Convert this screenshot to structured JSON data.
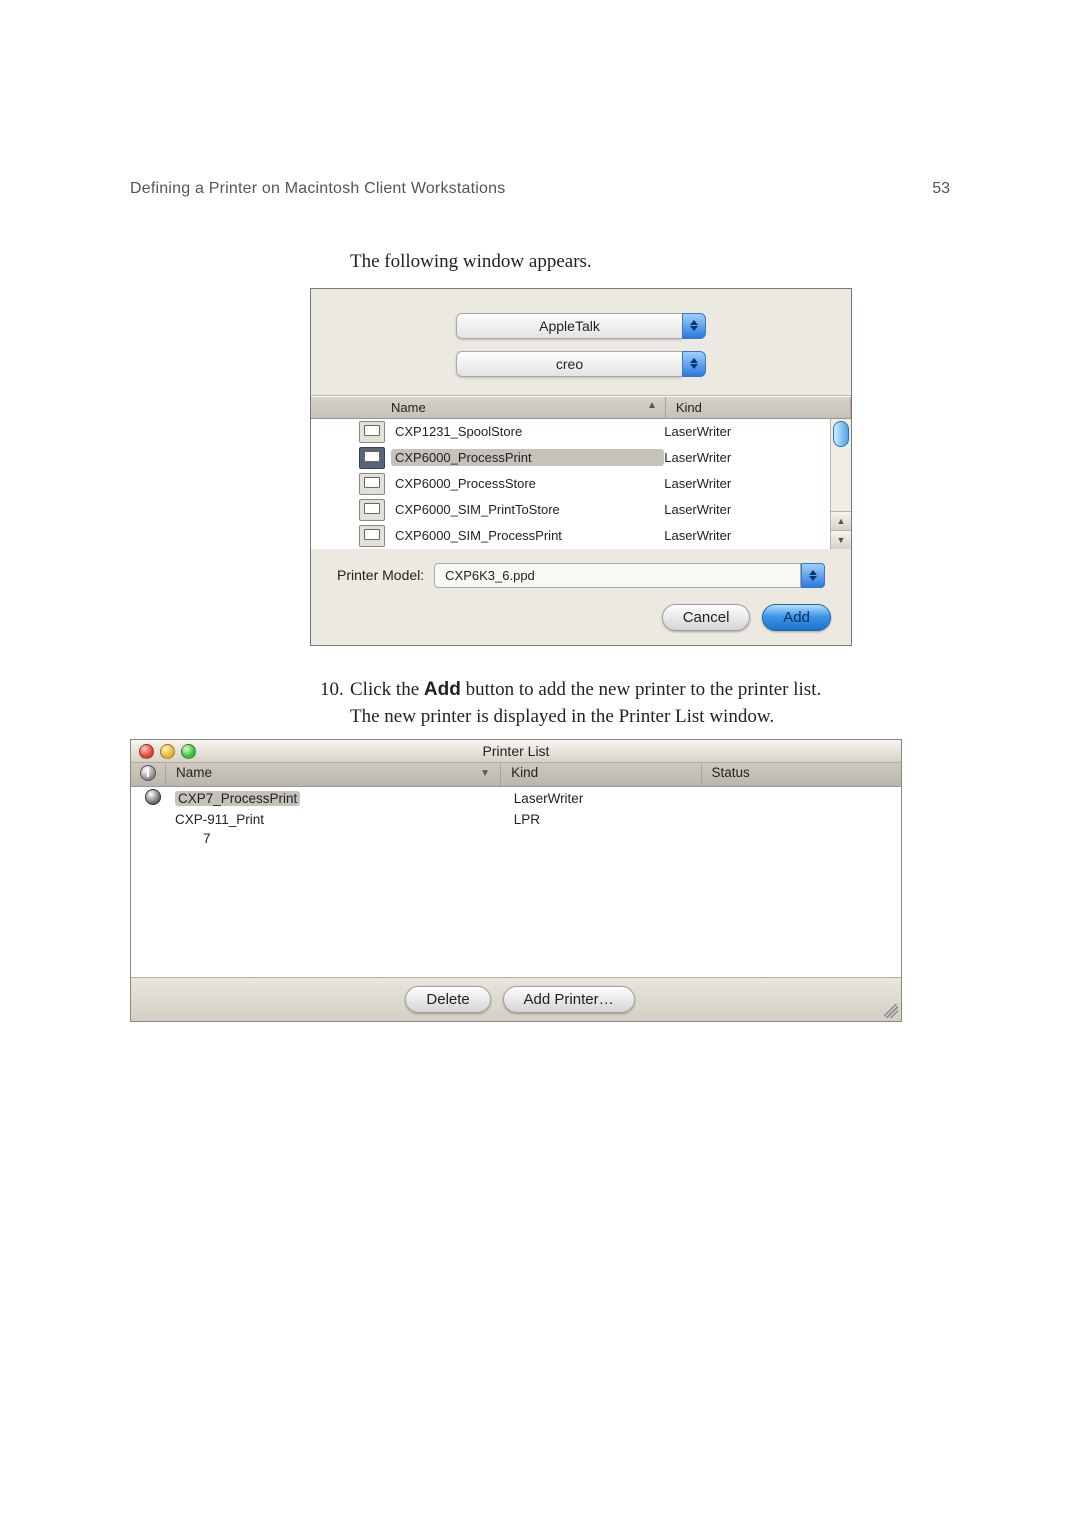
{
  "header": {
    "title": "Defining a Printer on Macintosh Client Workstations",
    "page_number": "53"
  },
  "intro_text": "The following window appears.",
  "dialog1": {
    "connection_select": "AppleTalk",
    "zone_select": "creo",
    "columns": {
      "name": "Name",
      "kind": "Kind"
    },
    "rows": [
      {
        "name": "CXP1231_SpoolStore",
        "kind": "LaserWriter",
        "selected": false
      },
      {
        "name": "CXP6000_ProcessPrint",
        "kind": "LaserWriter",
        "selected": true
      },
      {
        "name": "CXP6000_ProcessStore",
        "kind": "LaserWriter",
        "selected": false
      },
      {
        "name": "CXP6000_SIM_PrintToStore",
        "kind": "LaserWriter",
        "selected": false
      },
      {
        "name": "CXP6000_SIM_ProcessPrint",
        "kind": "LaserWriter",
        "selected": false
      }
    ],
    "printer_model_label": "Printer Model:",
    "printer_model_value": "CXP6K3_6.ppd",
    "cancel_label": "Cancel",
    "add_label": "Add"
  },
  "step10": {
    "number": "10.",
    "line1_prefix": "Click the ",
    "line1_bold": "Add",
    "line1_suffix": " button to add the new printer to the printer list.",
    "line2": "The new printer is displayed in the Printer List window."
  },
  "printer_list": {
    "window_title": "Printer List",
    "columns": {
      "name": "Name",
      "kind": "Kind",
      "status": "Status"
    },
    "rows": [
      {
        "name": "CXP7_ProcessPrint",
        "kind": "LaserWriter",
        "status": "",
        "selected": true,
        "default": true
      },
      {
        "name": "CXP-911_Print",
        "kind": "LPR",
        "status": "",
        "selected": false,
        "default": false
      }
    ],
    "extra_row_text": "7",
    "delete_label": "Delete",
    "add_printer_label": "Add Printer…"
  }
}
